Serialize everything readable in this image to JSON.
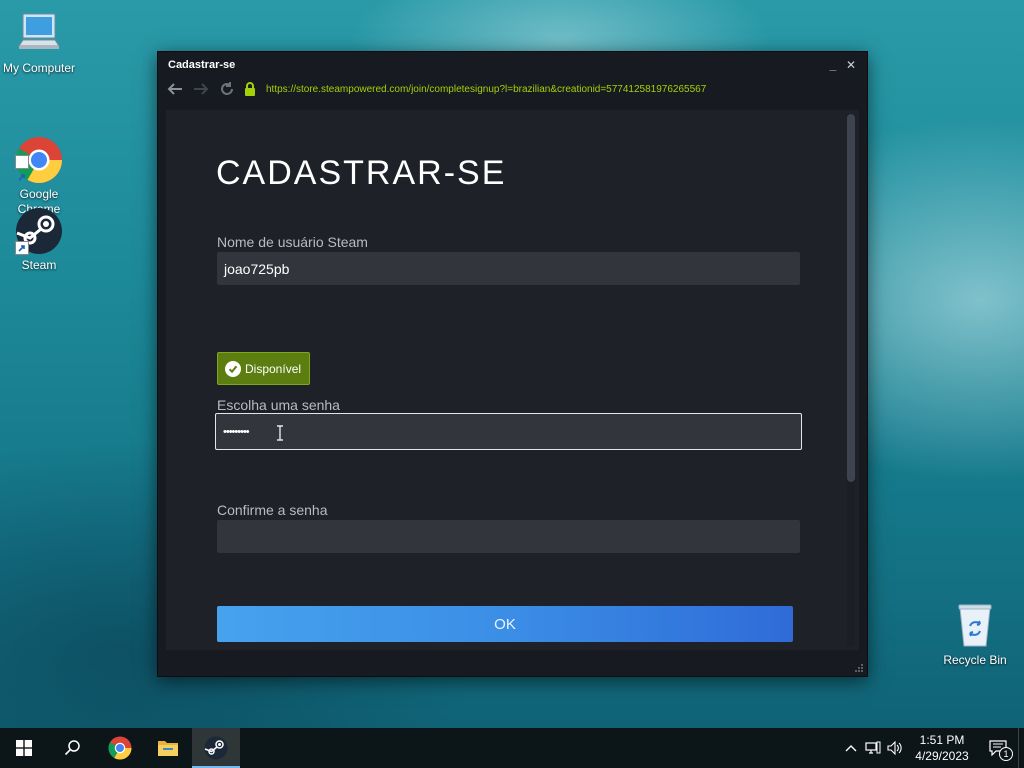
{
  "desktop": {
    "icons": [
      {
        "label": "My Computer",
        "icon": "computer-icon"
      },
      {
        "label": "Google\nChrome",
        "icon": "chrome-icon"
      },
      {
        "label": "Steam",
        "icon": "steam-icon"
      },
      {
        "label": "Recycle Bin",
        "icon": "recycle-bin-icon"
      }
    ]
  },
  "window": {
    "title": "Cadastrar-se",
    "minimize": "_",
    "close": "✕",
    "url": "https://store.steampowered.com/join/completesignup?l=brazilian&creationid=577412581976265567"
  },
  "form": {
    "title": "CADASTRAR-SE",
    "username_label": "Nome de usuário Steam",
    "username_value": "joao725pb",
    "availability": "Disponível",
    "password_label": "Escolha uma senha",
    "password_value": "•••••••••",
    "confirm_label": "Confirme a senha",
    "confirm_value": "",
    "ok_button": "OK"
  },
  "colors": {
    "accent_green": "#5c7e10",
    "url_green": "#a4d007",
    "ok_blue": "#3b8ee6",
    "panel_bg": "#1e2127"
  },
  "taskbar": {
    "time": "1:51 PM",
    "date": "4/29/2023",
    "notification_count": "1",
    "apps": [
      "start-icon",
      "search-icon",
      "chrome-icon",
      "file-explorer-icon",
      "steam-icon"
    ]
  }
}
